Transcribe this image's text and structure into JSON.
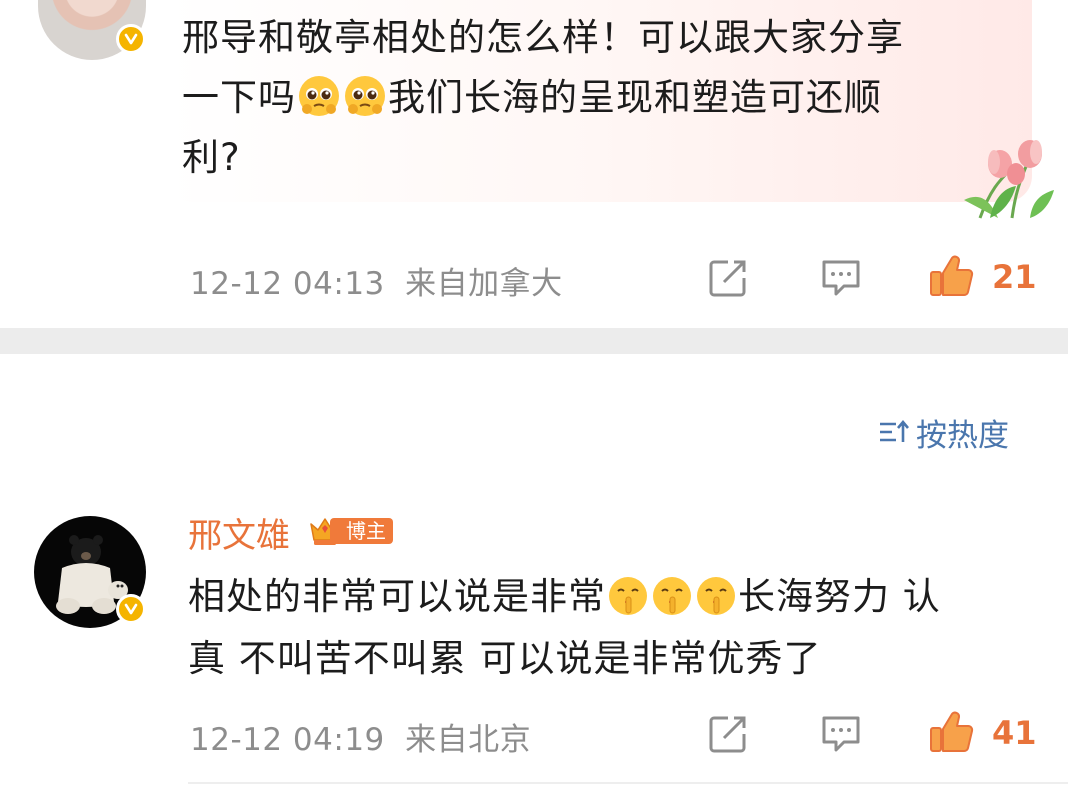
{
  "comment": {
    "text_line1": "邢导和敬亭相处的怎么样！可以跟大家分享",
    "text_line2_a": "一下吗",
    "text_line2_b": "我们长海的呈现和塑造可还顺",
    "text_line3": "利?",
    "emoji": "pleading-face-emoji",
    "date": "12-12 04:13",
    "source": "来自加拿大",
    "like_count": "21"
  },
  "sort": {
    "label": "按热度"
  },
  "reply": {
    "author": "邢文雄",
    "badge": "博主",
    "text_line1_a": "相处的非常可以说是非常",
    "text_line1_b": "长海努力 认",
    "text_line2": "真 不叫苦不叫累 可以说是非常优秀了",
    "emoji": "shushing-face-emoji",
    "date": "12-12 04:19",
    "source": "来自北京",
    "like_count": "41"
  },
  "colors": {
    "accent_orange": "#e8733a",
    "link_blue": "#4a76ad",
    "meta_gray": "#8d8d8d",
    "verify_yellow": "#f5b400"
  }
}
